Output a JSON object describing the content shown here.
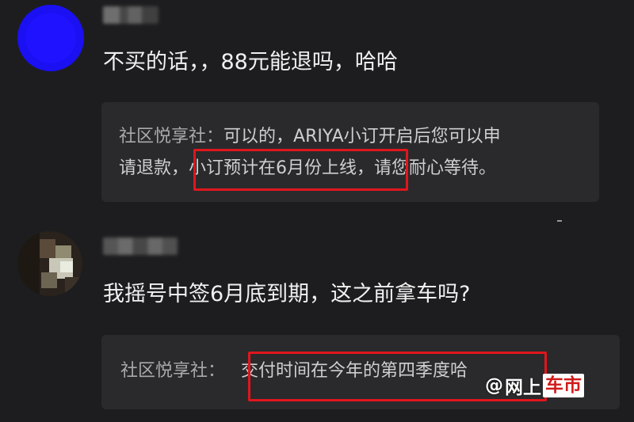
{
  "comments": [
    {
      "text": "不买的话，，88元能退吗，哈哈",
      "reply": {
        "author": "社区悦享社：",
        "line1_text": "可以的，ARIYA小订开启后您可以申",
        "line2_text": "请退款，小订预计在6月份上线，请您耐心等待。"
      }
    },
    {
      "text": "我摇号中签6月底到期，这之前拿车吗?",
      "reply": {
        "author": "社区悦享社：",
        "line1_text": "交付时间在今年的第四季度哈"
      }
    }
  ],
  "watermark": {
    "at": "@",
    "part1": "网上",
    "part2": "车市"
  },
  "colors": {
    "background": "#1d1d1f",
    "reply_box": "#2a2a2c",
    "highlight": "#e0161d",
    "avatar1": "#1a10f2"
  }
}
